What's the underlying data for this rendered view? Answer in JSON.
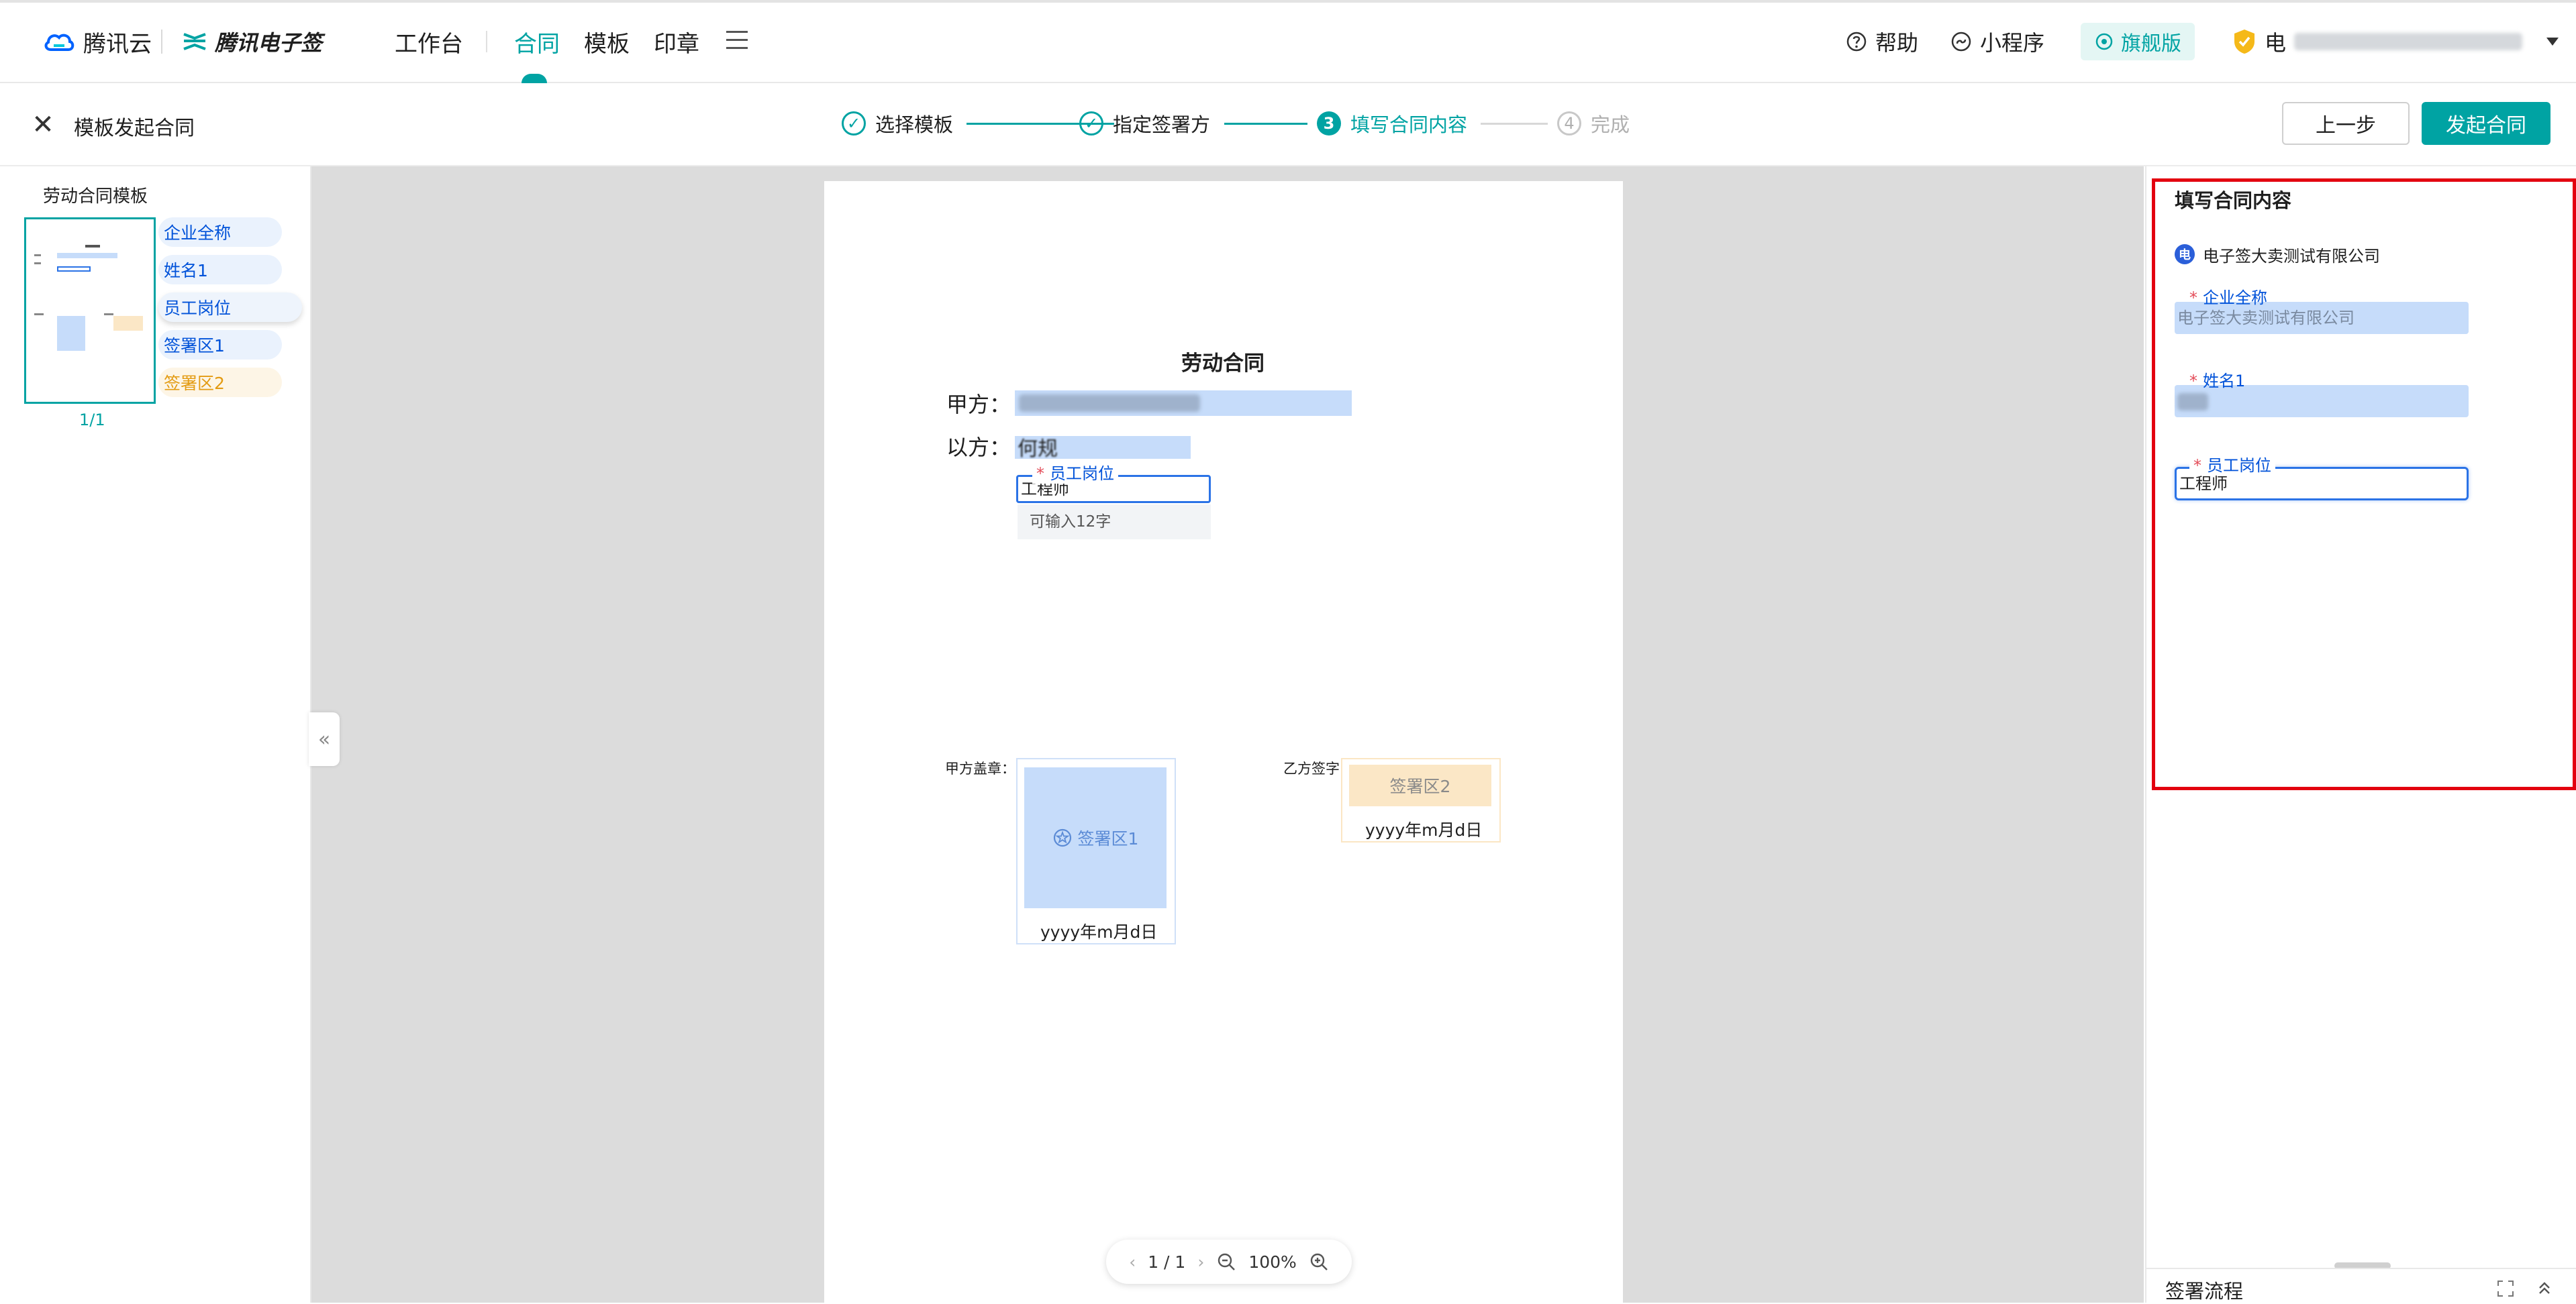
{
  "brand": {
    "tencent_cloud": "腾讯云",
    "esign": "腾讯电子签"
  },
  "nav": {
    "items": [
      "工作台",
      "合同",
      "模板",
      "印章"
    ],
    "active_index": 1,
    "help": "帮助",
    "mini_program": "小程序",
    "edition": "旗舰版",
    "user_initial": "电"
  },
  "stepbar": {
    "title": "模板发起合同",
    "steps": [
      {
        "num": "1",
        "label": "选择模板",
        "state": "done"
      },
      {
        "num": "2",
        "label": "指定签署方",
        "state": "done"
      },
      {
        "num": "3",
        "label": "填写合同内容",
        "state": "current"
      },
      {
        "num": "4",
        "label": "完成",
        "state": "todo"
      }
    ],
    "prev_button": "上一步",
    "start_button": "发起合同"
  },
  "left_panel": {
    "template_name": "劳动合同模板",
    "page_indicator": "1/1",
    "fields": [
      {
        "label": "企业全称",
        "style": "blue"
      },
      {
        "label": "姓名1",
        "style": "blue"
      },
      {
        "label": "员工岗位",
        "style": "active"
      },
      {
        "label": "签署区1",
        "style": "blue"
      },
      {
        "label": "签署区2",
        "style": "orange"
      }
    ]
  },
  "document": {
    "title": "劳动合同",
    "party_a_label": "甲方：",
    "party_b_label": "以方：",
    "party_b_value": "何规",
    "position_field": {
      "label": "员工岗位",
      "value": "工程师",
      "hint": "可输入12字"
    },
    "party_a_seal_caption": "甲方盖章：",
    "party_b_sign_caption": "乙方签字",
    "sign_area_1": "签署区1",
    "sign_area_2": "签署区2",
    "date_format": "yyyy年m月d日",
    "pager": {
      "page": "1 / 1",
      "zoom": "100%"
    }
  },
  "right_panel": {
    "title": "填写合同内容",
    "company_badge": "电",
    "company": "电子签大卖测试有限公司",
    "fields": [
      {
        "label": "企业全称",
        "value": "电子签大卖测试有限公司"
      },
      {
        "label": "姓名1",
        "value": ""
      },
      {
        "label": "员工岗位",
        "value": "工程师"
      }
    ],
    "flow_title": "签署流程"
  },
  "colors": {
    "accent": "#00a3a3",
    "field_blue": "#c6dcfa",
    "link_blue": "#0052d9",
    "highlight_red": "#e3000f",
    "sign_orange": "#fbe7c6"
  }
}
